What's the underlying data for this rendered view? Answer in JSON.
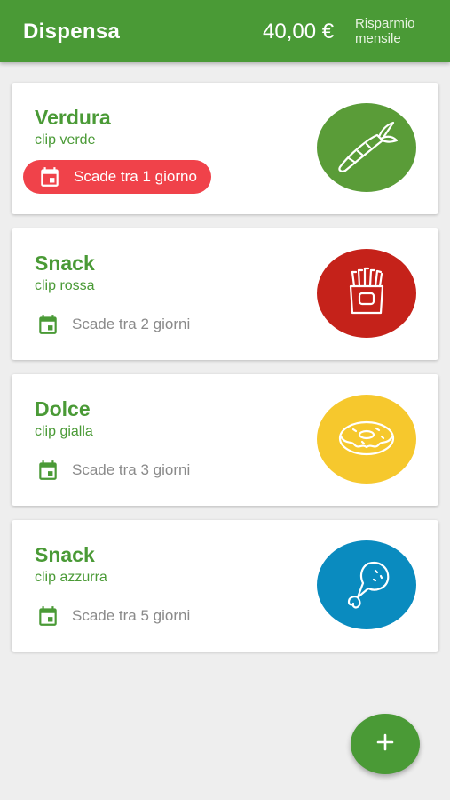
{
  "appbar": {
    "title": "Dispensa",
    "amount": "40,00 €",
    "savings_label_line1": "Risparmio",
    "savings_label_line2": "mensile"
  },
  "items": [
    {
      "category": "Verdura",
      "clip": "clip verde",
      "expiry": "Scade tra 1 giorno",
      "urgent": true,
      "color": "#5a9c38",
      "icon": "carrot-icon"
    },
    {
      "category": "Snack",
      "clip": "clip rossa",
      "expiry": "Scade tra 2 giorni",
      "urgent": false,
      "color": "#c5221a",
      "icon": "fries-icon"
    },
    {
      "category": "Dolce",
      "clip": "clip gialla",
      "expiry": "Scade tra 3 giorni",
      "urgent": false,
      "color": "#f6c82d",
      "icon": "donut-icon"
    },
    {
      "category": "Snack",
      "clip": "clip azzurra",
      "expiry": "Scade tra 5 giorni",
      "urgent": false,
      "color": "#0a8bbf",
      "icon": "chicken-leg-icon"
    }
  ],
  "fab": {
    "symbol": "+",
    "icon": "plus-icon"
  },
  "colors": {
    "primary": "#4a9a36",
    "urgent": "#f0424a",
    "muted_text": "#8a8a8a",
    "background": "#eeeeee"
  }
}
